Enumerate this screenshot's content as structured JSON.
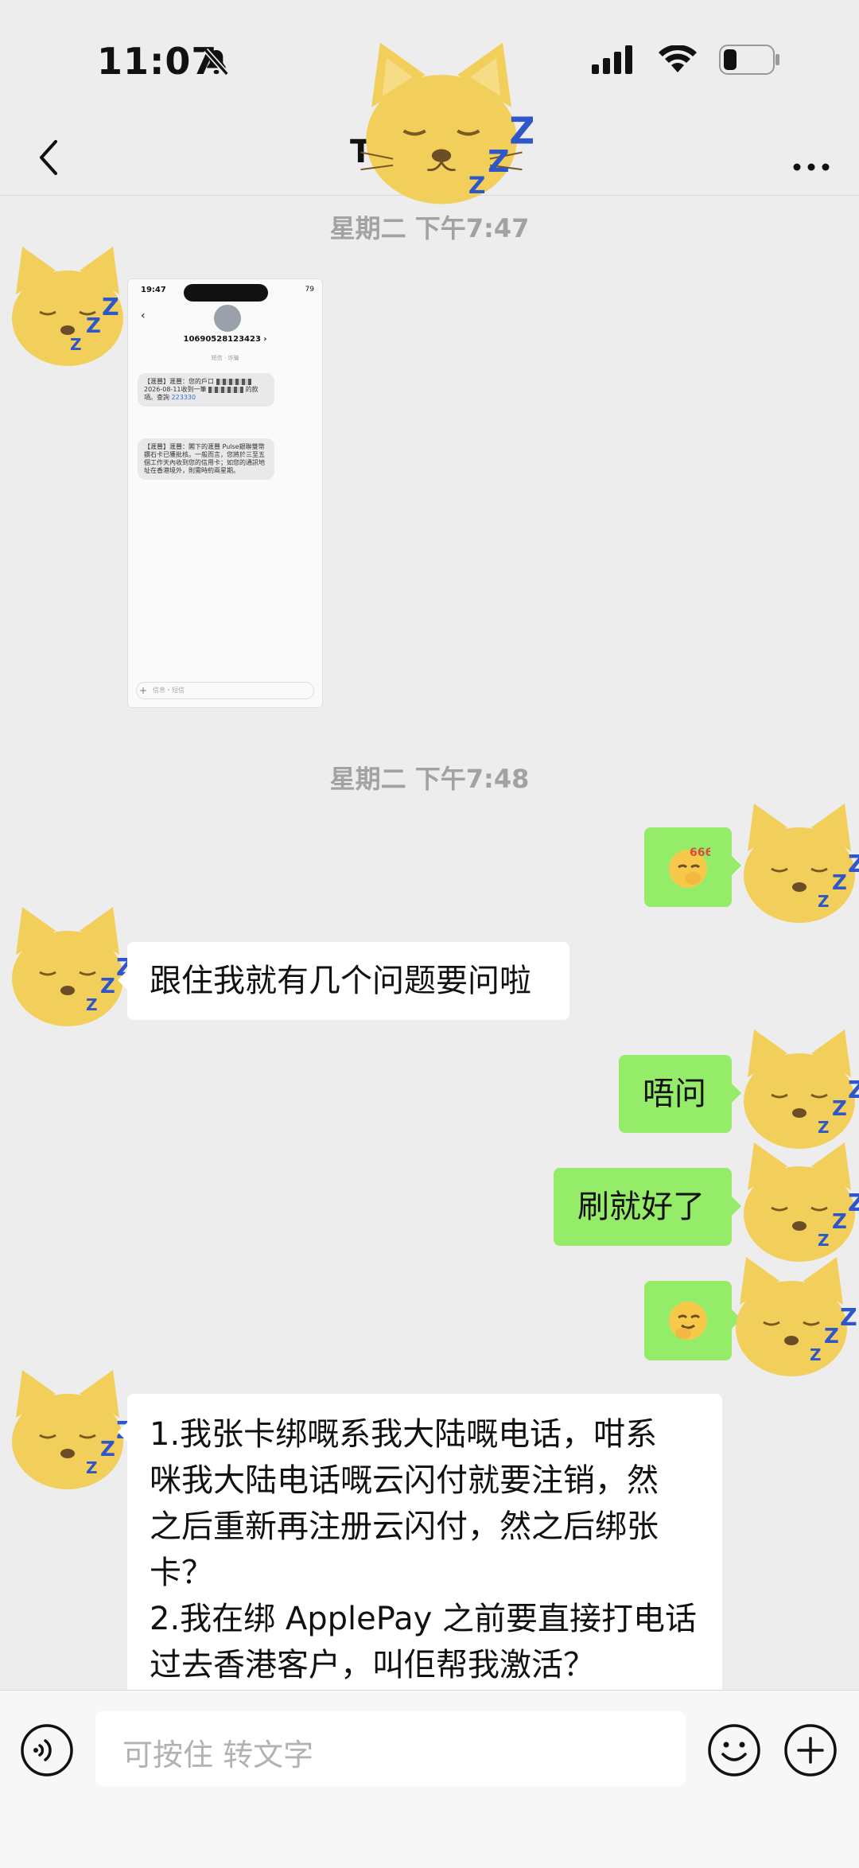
{
  "status_bar": {
    "time": "11:07"
  },
  "nav": {
    "title": "T"
  },
  "timestamps": [
    "星期二 下午7:47",
    "星期二 下午7:48"
  ],
  "image_message": {
    "time": "19:47",
    "battery": "79",
    "sender_number": "10690528123423 ›",
    "subtitle": "短信 · 诈骗",
    "sms_1": "【滙豐】滙豐：您的戶口",
    "sms_1_b": "2026-08-11收到一筆",
    "sms_1_c": "的款項。查詢",
    "sms_1_link": "223330",
    "sms_2": "【滙豐】滙豐：閣下的滙豐 Pulse銀聯雙幣鑽石卡已獲批核。一般而言，您將於三至五個工作天內收到您的信用卡；如您的通訊地址在香港境外，則需時約兩星期。",
    "input_placeholder": "信息・短信"
  },
  "messages": [
    {
      "side": "right",
      "type": "emoji",
      "text": "666"
    },
    {
      "side": "left",
      "type": "text",
      "text": "跟住我就有几个问题要问啦"
    },
    {
      "side": "right",
      "type": "text",
      "text": "唔问"
    },
    {
      "side": "right",
      "type": "text",
      "text": "刷就好了"
    },
    {
      "side": "right",
      "type": "emoji",
      "text": ""
    },
    {
      "side": "left",
      "type": "text",
      "text": "1.我张卡绑嘅系我大陆嘅电话，咁系\n咪我大陆电话嘅云闪付就要注销，然\n之后重新再注册云闪付，然之后绑张\n卡？\n2.我在绑 ApplePay 之前要直接打电话\n过去香港客户，叫佢帮我激活？"
    }
  ],
  "input_bar": {
    "placeholder": "可按住 转文字"
  },
  "colors": {
    "bubble_self": "#95ec69",
    "bubble_other": "#ffffff",
    "background": "#ededed",
    "avatar_cat": "#f2cf5b",
    "zzz": "#2f57c9"
  },
  "icons": {
    "back": "chevron-left-icon",
    "more": "more-dots-icon",
    "voice": "voice-icon",
    "emoji": "smiley-icon",
    "plus": "plus-icon",
    "mute": "bell-slash-icon",
    "signal": "signal-icon",
    "wifi": "wifi-icon",
    "battery": "battery-icon"
  }
}
